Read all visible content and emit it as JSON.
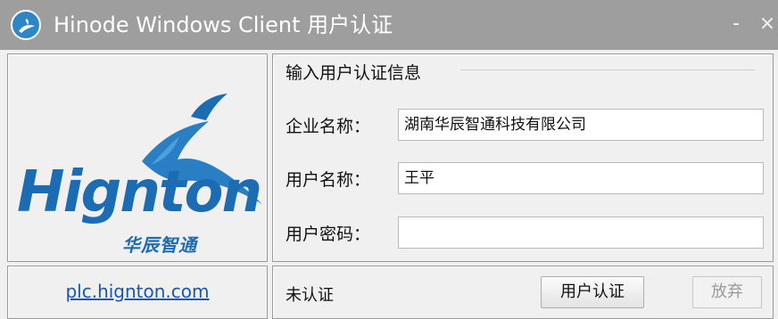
{
  "window": {
    "title": "Hinode Windows Client 用户认证",
    "minimize_glyph": "-",
    "close_glyph": "×",
    "title_bar_color": "#9e9e9e"
  },
  "logo": {
    "wordmark": "Hignton",
    "chinese_name": "华辰智通",
    "brand_color": "#1b6cb3"
  },
  "form": {
    "group_title": "输入用户认证信息",
    "fields": [
      {
        "label": "企业名称：",
        "value": "湖南华辰智通科技有限公司"
      },
      {
        "label": "用户名称：",
        "value": "王平"
      },
      {
        "label": "用户密码：",
        "value": ""
      }
    ]
  },
  "footer": {
    "link_text": "plc.hignton.com",
    "status": "未认证",
    "auth_button": "用户认证",
    "cancel_button": "放弃"
  },
  "icons": {
    "app": "client-logo-icon",
    "minimize": "minimize-icon",
    "close": "close-icon"
  }
}
